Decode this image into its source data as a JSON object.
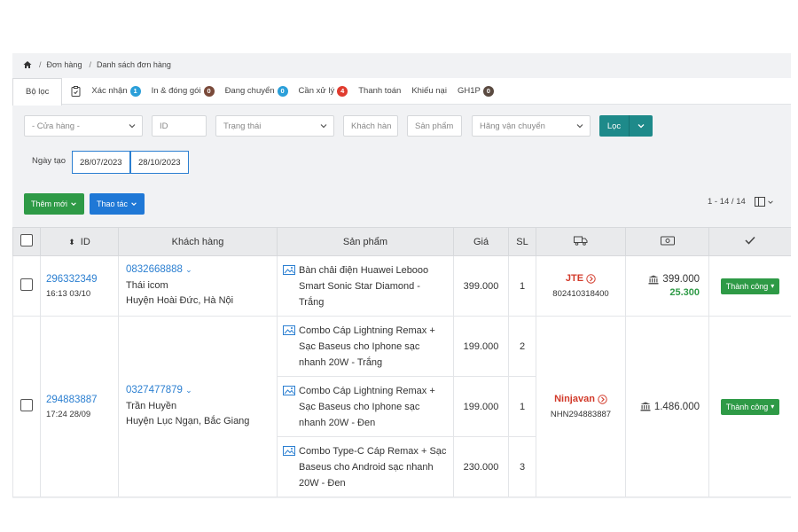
{
  "breadcrumb": {
    "level1": "Đơn hàng",
    "level2": "Danh sách đơn hàng"
  },
  "tabs": [
    {
      "label": "Bộ lọc",
      "badge": null
    },
    {
      "label": "Xác nhận",
      "badge": "1",
      "badge_color": "#2b9fd9"
    },
    {
      "label": "In & đóng gói",
      "badge": "0",
      "badge_color": "#7a4a3a"
    },
    {
      "label": "Đang chuyển",
      "badge": "0",
      "badge_color": "#2b9fd9"
    },
    {
      "label": "Cần xử lý",
      "badge": "4",
      "badge_color": "#e03b2e"
    },
    {
      "label": "Thanh toán",
      "badge": null
    },
    {
      "label": "Khiếu nại",
      "badge": null
    },
    {
      "label": "GH1P",
      "badge": "0",
      "badge_color": "#5a4a40"
    }
  ],
  "filters": {
    "store_placeholder": "- Cửa hàng -",
    "id_placeholder": "ID",
    "status_placeholder": "Trạng thái",
    "customer_placeholder": "Khách hàn",
    "product_placeholder": "Sản phẩm",
    "carrier_placeholder": "Hãng vận chuyển",
    "filter_button": "Lọc",
    "date_label": "Ngày tạo",
    "date_from": "28/07/2023",
    "date_to": "28/10/2023"
  },
  "actions": {
    "add_label": "Thêm mới",
    "ops_label": "Thao tác"
  },
  "pager": {
    "text": "1 - 14 / 14"
  },
  "table": {
    "headers": {
      "id": "ID",
      "customer": "Khách hàng",
      "product": "Sản phẩm",
      "price": "Giá",
      "qty": "SL"
    },
    "orders": [
      {
        "id": "296332349",
        "time": "16:13 03/10",
        "phone": "0832668888",
        "name": "Thái icom",
        "address": "Huyện Hoài Đức, Hà Nội",
        "items": [
          {
            "product": "Bàn chải điện Huawei Lebooo Smart Sonic Star Diamond - Trắng",
            "price": "399.000",
            "qty": "1"
          }
        ],
        "carrier": "JTE",
        "tracking": "802410318400",
        "total": "399.000",
        "cod": "25.300",
        "status": "Thành công"
      },
      {
        "id": "294883887",
        "time": "17:24 28/09",
        "phone": "0327477879",
        "name": "Trần Huyền",
        "address": "Huyện Lục Ngạn, Bắc Giang",
        "items": [
          {
            "product": "Combo Cáp Lightning Remax + Sạc Baseus cho Iphone sạc nhanh 20W - Trắng",
            "price": "199.000",
            "qty": "2"
          },
          {
            "product": "Combo Cáp Lightning Remax + Sạc Baseus cho Iphone sạc nhanh 20W - Đen",
            "price": "199.000",
            "qty": "1"
          },
          {
            "product": "Combo Type-C Cáp Remax + Sạc Baseus cho Android sạc nhanh 20W - Đen",
            "price": "230.000",
            "qty": "3"
          }
        ],
        "carrier": "Ninjavan",
        "tracking": "NHN294883887",
        "total": "1.486.000",
        "cod": "",
        "status": "Thành công"
      }
    ]
  },
  "colors": {
    "primary_blue": "#2b7fd1",
    "success_green": "#2e9a46",
    "teal": "#1e8a8a",
    "carrier_red": "#d23a2a"
  },
  "icons": [
    "home-icon",
    "clipboard-icon",
    "truck-icon",
    "cash-icon",
    "check-icon",
    "image-icon",
    "bank-icon",
    "chevron-down-icon",
    "circle-arrow-icon",
    "columns-icon"
  ]
}
